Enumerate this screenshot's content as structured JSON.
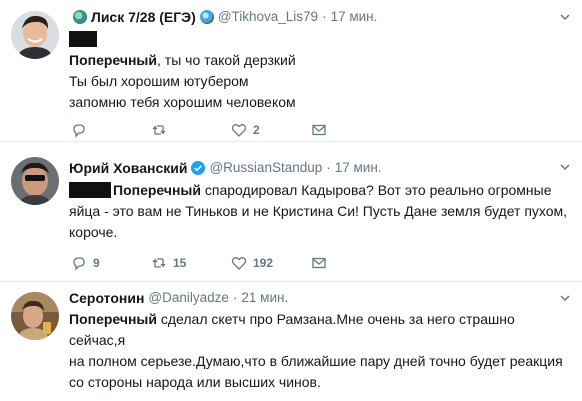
{
  "tweets": [
    {
      "name": "Лиск 7/28 (ЕГЭ)",
      "handle": "@Tikhova_Lis79",
      "time": "17 мин.",
      "mention": "Поперечный",
      "line1_rest": ", ты чо такой дерзкий",
      "line2": "Ты был хорошим ютубером",
      "line3": "запомню тебя хорошим человеком",
      "replies": "",
      "retweets": "",
      "likes": "2"
    },
    {
      "name": "Юрий Хованский",
      "handle": "@RussianStandup",
      "time": "17 мин.",
      "mention": "Поперечный",
      "line1_rest": " спародировал Кадырова? Вот это реально огромные",
      "line2": "яйца - это вам не Тиньков и не Кристина Си! Пусть Дане земля будет пухом,",
      "line3": "короче.",
      "replies": "9",
      "retweets": "15",
      "likes": "192"
    },
    {
      "name": "Серотонин",
      "handle": "@Danilyadze",
      "time": "21 мин.",
      "mention": "Поперечный",
      "line1_rest": " сделал скетч про Рамзана.Мне очень за него страшно  сейчас,я",
      "line2": "на полном серьезе.Думаю,что в ближайшие пару дней точно будет реакция",
      "line3": "со стороны народа или высших чинов.",
      "replies": "",
      "retweets": "",
      "likes": ""
    }
  ],
  "colors": {
    "text": "#14171a",
    "muted": "#657786",
    "divider": "#e6ecf0",
    "verified": "#1da1f2"
  },
  "icons": [
    "reply-icon",
    "retweet-icon",
    "like-icon",
    "message-icon",
    "chevron-down-icon",
    "verified-icon"
  ]
}
